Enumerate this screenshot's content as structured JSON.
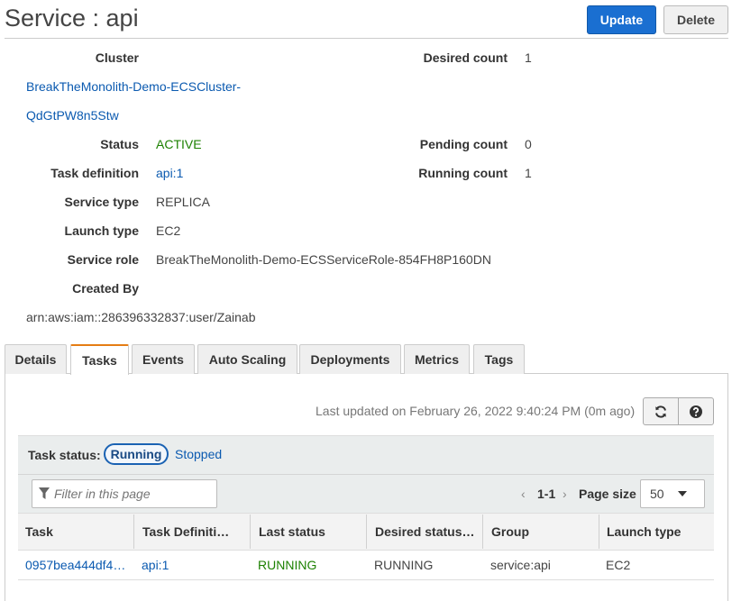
{
  "header": {
    "title": "Service : api",
    "update_label": "Update",
    "delete_label": "Delete"
  },
  "details": {
    "cluster_label": "Cluster",
    "cluster_line1": "BreakTheMonolith-Demo-ECSCluster-",
    "cluster_line2": "QdGtPW8n5Stw",
    "status_label": "Status",
    "status_value": "ACTIVE",
    "task_definition_label": "Task definition",
    "task_definition_value": "api:1",
    "service_type_label": "Service type",
    "service_type_value": "REPLICA",
    "launch_type_label": "Launch type",
    "launch_type_value": "EC2",
    "service_role_label": "Service role",
    "service_role_value": "BreakTheMonolith-Demo-ECSServiceRole-854FH8P160DN",
    "created_by_label": "Created By",
    "created_by_value": "arn:aws:iam::286396332837:user/Zainab",
    "desired_count_label": "Desired count",
    "desired_count_value": "1",
    "pending_count_label": "Pending count",
    "pending_count_value": "0",
    "running_count_label": "Running count",
    "running_count_value": "1"
  },
  "tabs": [
    {
      "label": "Details"
    },
    {
      "label": "Tasks"
    },
    {
      "label": "Events"
    },
    {
      "label": "Auto Scaling"
    },
    {
      "label": "Deployments"
    },
    {
      "label": "Metrics"
    },
    {
      "label": "Tags"
    }
  ],
  "active_tab": "Tasks",
  "tasks_panel": {
    "last_updated": "Last updated on February 26, 2022 9:40:24 PM (0m ago)",
    "refresh_icon": "refresh-icon",
    "help_icon": "question-circle-icon",
    "task_status_label": "Task status:",
    "filter_running": "Running",
    "filter_stopped": "Stopped",
    "filter_placeholder": "Filter in this page",
    "filter_icon": "funnel-icon",
    "pager_prev": "‹",
    "pager_range": "1-1",
    "pager_next": "›",
    "page_size_label": "Page size",
    "page_size_value": "50",
    "columns": [
      "Task",
      "Task Definiti…",
      "Last status",
      "Desired status…",
      "Group",
      "Launch type"
    ],
    "rows": [
      {
        "task": "0957bea444df4…",
        "task_definition": "api:1",
        "last_status": "RUNNING",
        "desired_status": "RUNNING",
        "group": "service:api",
        "launch_type": "EC2"
      }
    ]
  },
  "colors": {
    "primary": "#1a6fd1",
    "link": "#0b5ab0",
    "success": "#1d8102",
    "active_tab_accent": "#e57d14"
  }
}
